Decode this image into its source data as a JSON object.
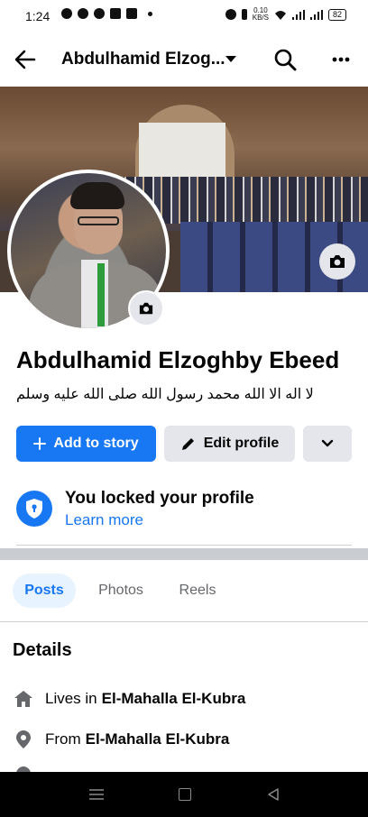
{
  "status_bar": {
    "time": "1:24",
    "net_speed_value": "0.10",
    "net_speed_unit": "KB/S",
    "battery": "82"
  },
  "top_bar": {
    "title": "Abdulhamid Elzog...",
    "icons": [
      "back-arrow-icon",
      "chevron-down-icon",
      "search-icon",
      "more-icon"
    ]
  },
  "profile": {
    "name": "Abdulhamid Elzoghby Ebeed",
    "bio": "لا اله الا الله محمد رسول الله صلى الله عليه وسلم"
  },
  "actions": {
    "add_story_label": "Add to story",
    "edit_profile_label": "Edit profile"
  },
  "lock_notice": {
    "title": "You locked your profile",
    "link": "Learn more"
  },
  "tabs": [
    {
      "label": "Posts",
      "active": true
    },
    {
      "label": "Photos",
      "active": false
    },
    {
      "label": "Reels",
      "active": false
    }
  ],
  "details": {
    "heading": "Details",
    "items": [
      {
        "icon": "home-icon",
        "label": "Lives in",
        "value": "El-Mahalla El-Kubra"
      },
      {
        "icon": "location-pin-icon",
        "label": "From",
        "value": "El-Mahalla El-Kubra"
      }
    ]
  },
  "colors": {
    "accent": "#1877f2",
    "button_gray": "#e4e6eb",
    "tab_active_bg": "#e7f3ff",
    "secondary_text": "#65676b"
  }
}
